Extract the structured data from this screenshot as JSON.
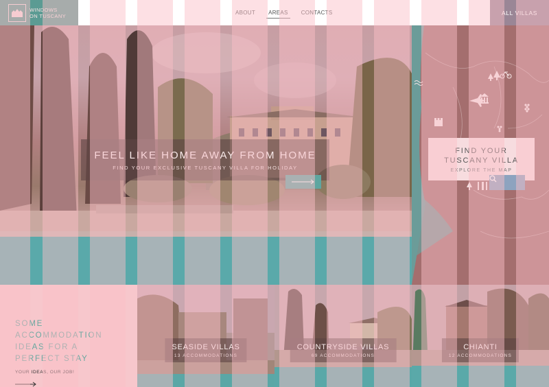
{
  "header": {
    "logo_line1": "Windows",
    "logo_line2": "on Tuscany",
    "nav": [
      {
        "label": "About"
      },
      {
        "label": "Areas"
      },
      {
        "label": "Contacts"
      }
    ],
    "cta_label": "All Villas"
  },
  "hero": {
    "title": "Feel like home away from home",
    "subtitle": "Find your exclusive Tuscany villa for holiday",
    "arrow_icon": "arrow-right-icon"
  },
  "map": {
    "title_line1": "Find your",
    "title_line2": "Tuscany villa",
    "subtitle": "Explore the map",
    "search_icon": "search-icon",
    "icons": [
      "trees-icon",
      "bicycle-icon",
      "castle-icon",
      "airplane-icon",
      "temple-icon",
      "grapes-icon",
      "wave-icon",
      "fork-knife-icon"
    ]
  },
  "promo": {
    "title": "Some accommodation ideas for a perfect stay",
    "tagline": "Your ideas, our job!"
  },
  "cards": [
    {
      "title": "Seaside Villas",
      "count": "13 Accommodations"
    },
    {
      "title": "Countryside Villas",
      "count": "69 Accommodations"
    },
    {
      "title": "Chianti",
      "count": "12 Accommodations"
    }
  ],
  "colors": {
    "teal": "#5b9b93",
    "pink": "#f7c7cc",
    "mauve": "#9a8696",
    "map_brown": "#a46e6e",
    "search_blue": "#8da3bf"
  }
}
